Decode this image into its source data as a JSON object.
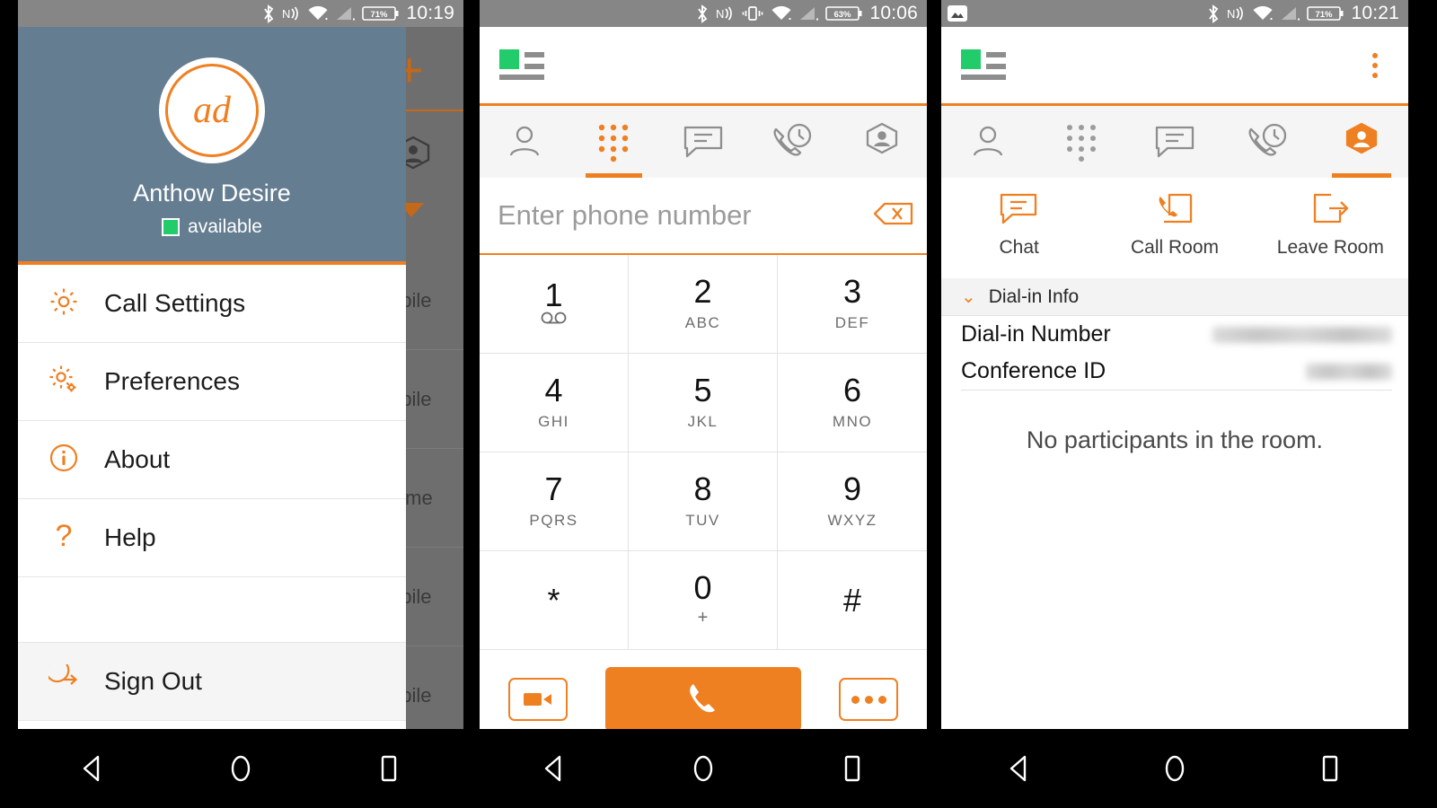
{
  "colors": {
    "accent": "#ef8022",
    "green": "#23cc6b",
    "profile_bg": "#657d91",
    "statusbar": "#868686"
  },
  "panel1": {
    "status_bar": {
      "time": "10:19",
      "battery": "71%",
      "icons": [
        "bluetooth-icon",
        "nfc-icon",
        "wifi-icon",
        "signal-icon",
        "battery-icon"
      ]
    },
    "profile": {
      "initials": "ad",
      "name": "Anthow Desire",
      "presence": "available"
    },
    "menu": [
      {
        "label": "Call Settings",
        "icon": "gear-icon"
      },
      {
        "label": "Preferences",
        "icon": "gears-icon"
      },
      {
        "label": "About",
        "icon": "info-icon"
      },
      {
        "label": "Help",
        "icon": "question-icon"
      },
      {
        "label": "Sign Out",
        "icon": "sign-out-icon"
      }
    ],
    "background_rows": [
      "obile",
      "obile",
      "lome",
      "obile",
      "obile"
    ]
  },
  "panel2": {
    "status_bar": {
      "time": "10:06",
      "battery": "63%",
      "icons": [
        "bluetooth-icon",
        "nfc-icon",
        "vibrate-icon",
        "wifi-icon",
        "signal-icon",
        "battery-icon"
      ]
    },
    "tabs": [
      {
        "name": "contacts",
        "icon": "person-icon",
        "active": false
      },
      {
        "name": "dialpad",
        "icon": "dialpad-icon",
        "active": true
      },
      {
        "name": "chat",
        "icon": "message-icon",
        "active": false
      },
      {
        "name": "history",
        "icon": "call-history-icon",
        "active": false
      },
      {
        "name": "rooms",
        "icon": "room-badge-icon",
        "active": false
      }
    ],
    "dial_field": {
      "placeholder": "Enter phone number",
      "value": "",
      "clear_icon": "backspace-icon"
    },
    "keys": [
      {
        "digit": "1",
        "sub": "",
        "sub_icon": "voicemail-icon"
      },
      {
        "digit": "2",
        "sub": "ABC",
        "sub_icon": ""
      },
      {
        "digit": "3",
        "sub": "DEF",
        "sub_icon": ""
      },
      {
        "digit": "4",
        "sub": "GHI",
        "sub_icon": ""
      },
      {
        "digit": "5",
        "sub": "JKL",
        "sub_icon": ""
      },
      {
        "digit": "6",
        "sub": "MNO",
        "sub_icon": ""
      },
      {
        "digit": "7",
        "sub": "PQRS",
        "sub_icon": ""
      },
      {
        "digit": "8",
        "sub": "TUV",
        "sub_icon": ""
      },
      {
        "digit": "9",
        "sub": "WXYZ",
        "sub_icon": ""
      },
      {
        "digit": "*",
        "sub": "",
        "sub_icon": ""
      },
      {
        "digit": "0",
        "sub": "+",
        "sub_icon": ""
      },
      {
        "digit": "#",
        "sub": "",
        "sub_icon": ""
      }
    ],
    "actions": {
      "video": "video-call-icon",
      "call": "phone-icon",
      "more": "more-icon"
    }
  },
  "panel3": {
    "status_bar": {
      "time": "10:21",
      "battery": "71%",
      "notification_icon": "screenshot-icon",
      "icons": [
        "bluetooth-icon",
        "nfc-icon",
        "wifi-icon",
        "signal-icon",
        "battery-icon"
      ]
    },
    "overflow_icon": "kebab-menu-icon",
    "tabs": [
      {
        "name": "contacts",
        "icon": "person-icon",
        "active": false
      },
      {
        "name": "dialpad",
        "icon": "dialpad-icon",
        "active": false
      },
      {
        "name": "chat",
        "icon": "message-icon",
        "active": false
      },
      {
        "name": "history",
        "icon": "call-history-icon",
        "active": false
      },
      {
        "name": "rooms",
        "icon": "room-badge-icon",
        "active": true
      }
    ],
    "room_actions": [
      {
        "label": "Chat",
        "icon": "chat-icon"
      },
      {
        "label": "Call Room",
        "icon": "call-room-icon"
      },
      {
        "label": "Leave Room",
        "icon": "leave-room-icon"
      }
    ],
    "dialin": {
      "section_label": "Dial-in Info",
      "expanded": true,
      "rows": [
        {
          "label": "Dial-in Number",
          "value": "",
          "redacted": true
        },
        {
          "label": "Conference ID",
          "value": "",
          "redacted": true
        }
      ]
    },
    "empty_state": "No participants in the room."
  },
  "navbar": {
    "back": "back-triangle-icon",
    "home": "home-circle-icon",
    "recents": "recents-square-icon"
  }
}
